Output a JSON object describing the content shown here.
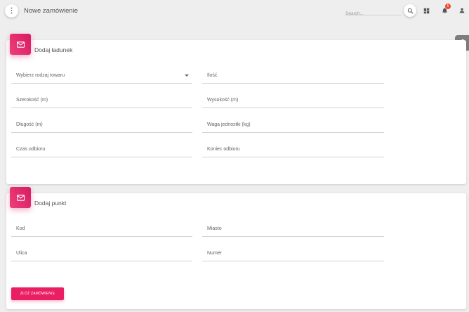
{
  "header": {
    "menu_icon": "more-vert-icon",
    "title": "Nowe zamówienie",
    "search_placeholder": "Search...",
    "search_icon": "search-icon",
    "dashboard_icon": "dashboard-icon",
    "notifications_icon": "bell-icon",
    "notifications_count": "5",
    "profile_icon": "person-icon"
  },
  "settings_icon": "gear-icon",
  "cargo_card": {
    "icon": "mail-icon",
    "title": "Dodaj ładunek",
    "fields": {
      "goods_type": "Wybierz rodzaj towaru",
      "quantity": "Ilość",
      "width": "Szerokość (m)",
      "height": "Wysokość (m)",
      "length": "Długość (m)",
      "unit_weight": "Waga jednostki (kg)",
      "pickup_time": "Czas odbioru",
      "pickup_end": "Koniec odbioru"
    }
  },
  "point_card": {
    "icon": "mail-icon",
    "title": "Dodaj punkt",
    "fields": {
      "code": "Kod",
      "city": "Miasto",
      "street": "Ulica",
      "number": "Numer"
    },
    "submit_label": "Złóż zamówienie"
  },
  "colors": {
    "accent": "#e91e63",
    "badge": "#f44336",
    "background": "#eeeeee"
  }
}
